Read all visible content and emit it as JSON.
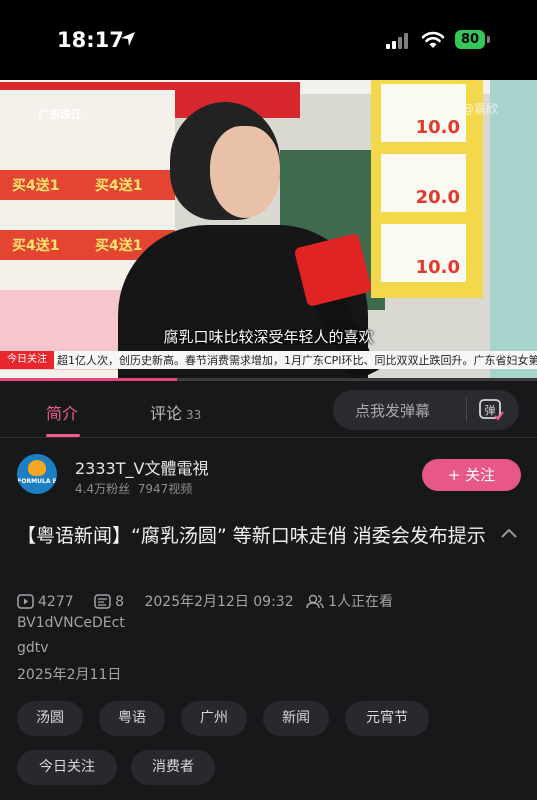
{
  "status_bar": {
    "time": "18:17",
    "battery": "80"
  },
  "video": {
    "caption": "腐乳口味比较深受年轻人的喜欢",
    "ticker": "超1亿人次，创历史新高。春节消费需求增加，1月广东CPI环比、同比双双止跌回升。广东省妇女第",
    "channel_logo": "广东珠江",
    "watermark": "@嘉欣",
    "ticker_logo": "今日关注",
    "sign_prices": [
      "10.0",
      "20.0",
      "10.0"
    ],
    "shelf_promo": "买4送1",
    "progress": 0.33
  },
  "tabs": [
    {
      "label": "简介"
    },
    {
      "label": "评论",
      "count": "33"
    }
  ],
  "danmaku": {
    "placeholder": "点我发弹幕",
    "icon_label": "弹"
  },
  "uploader": {
    "name": "2333T_V文體電視",
    "fans": "4.4万粉丝",
    "videos": "7947视频",
    "avatar_text": "FORMULA E",
    "follow_label": "+ 关注"
  },
  "video_info": {
    "title": "【粤语新闻】“腐乳汤圆” 等新口味走俏 消委会发布提示",
    "views": "4277",
    "danmaku_count": "8",
    "date": "2025年2月12日 09:32",
    "watching": "1人正在看",
    "bvid": "BV1dVNCeDEct",
    "source": "gdtv",
    "pub_date": "2025年2月11日"
  },
  "tags": [
    "汤圆",
    "粤语",
    "广州",
    "新闻",
    "元宵节",
    "今日关注",
    "消费者"
  ],
  "colors": {
    "accent": "#e8578a",
    "background": "#17181a"
  }
}
